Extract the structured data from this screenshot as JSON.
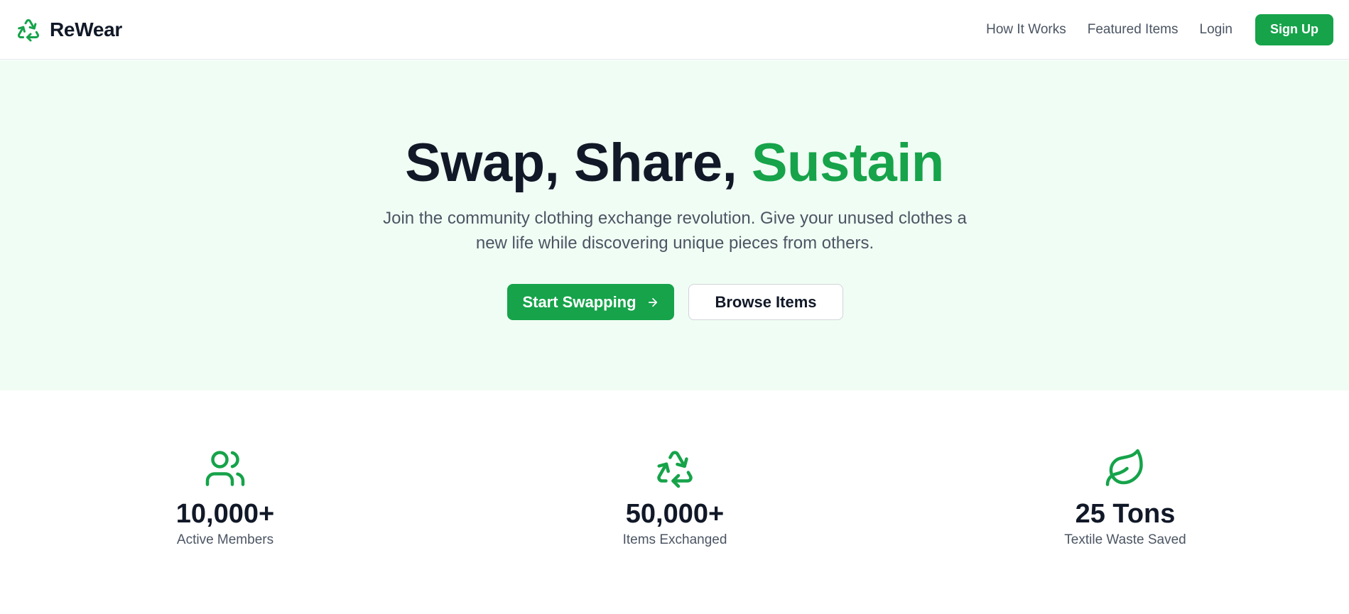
{
  "header": {
    "brand": "ReWear",
    "nav": [
      "How It Works",
      "Featured Items",
      "Login"
    ],
    "signup_label": "Sign Up"
  },
  "hero": {
    "title_part": "Swap, Share,",
    "title_accent": "Sustain",
    "subtitle": "Join the community clothing exchange revolution. Give your unused clothes a new life while discovering unique pieces from others.",
    "primary_cta": "Start Swapping",
    "secondary_cta": "Browse Items"
  },
  "stats": [
    {
      "icon": "users-icon",
      "value": "10,000+",
      "label": "Active Members"
    },
    {
      "icon": "recycle-icon",
      "value": "50,000+",
      "label": "Items Exchanged"
    },
    {
      "icon": "leaf-icon",
      "value": "25 Tons",
      "label": "Textile Waste Saved"
    }
  ],
  "colors": {
    "accent": "#16a34a",
    "hero_background": "#f0fdf4",
    "text_dark": "#111827",
    "text_muted": "#4b5563"
  }
}
